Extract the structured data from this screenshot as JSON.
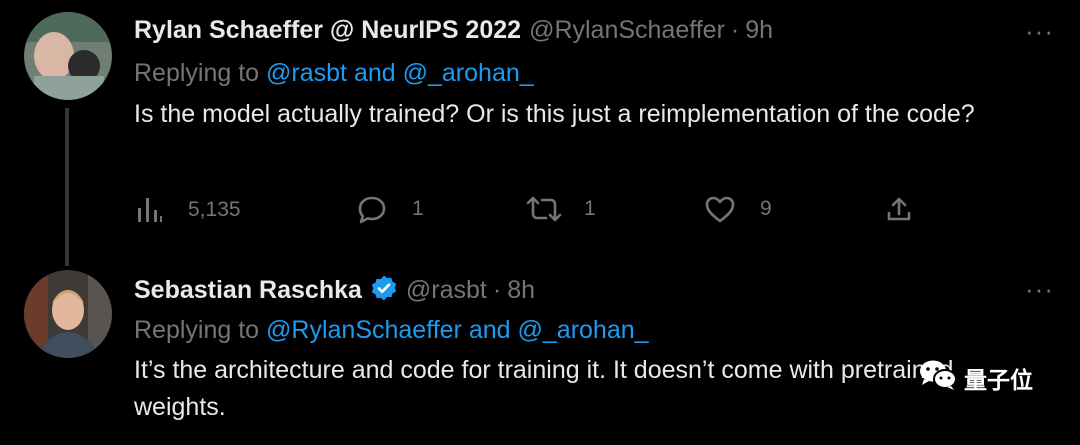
{
  "tweets": [
    {
      "author": "Rylan Schaeffer @ NeurIPS 2022",
      "handle": "@RylanSchaeffer",
      "dot": "·",
      "time": "9h",
      "more": "···",
      "replying_prefix": "Replying to",
      "replying_user1": "@rasbt",
      "replying_and": "and",
      "replying_user2": "@_arohan_",
      "text": "Is the model actually trained? Or is this just a reimplementation of the code?",
      "views": "5,135",
      "replies": "1",
      "retweets": "1",
      "likes": "9"
    },
    {
      "author": "Sebastian Raschka",
      "handle": "@rasbt",
      "dot": "·",
      "time": "8h",
      "more": "···",
      "replying_prefix": "Replying to",
      "replying_user1": "@RylanSchaeffer",
      "replying_and": "and",
      "replying_user2": "@_arohan_",
      "text": "It’s the architecture and code for training it. It doesn’t come with pretrained weights."
    }
  ],
  "watermark": "量子位",
  "colors": {
    "background": "#000000",
    "text": "#e7e9ea",
    "muted": "#71767b",
    "link": "#1d9bf0",
    "verified": "#1d9bf0"
  },
  "icons": [
    "analytics-icon",
    "reply-icon",
    "retweet-icon",
    "like-icon",
    "share-icon",
    "verified-badge-icon",
    "wechat-icon"
  ]
}
